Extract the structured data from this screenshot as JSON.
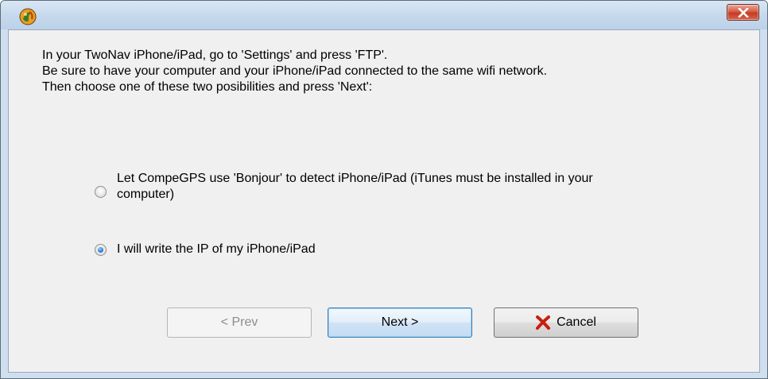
{
  "window": {
    "title": "",
    "icons": {
      "app": "compegps-app-icon",
      "close": "close-icon"
    },
    "colors": {
      "close_button": "#c63a22",
      "frame": "#cfdfef",
      "client_bg": "#f0f0f0",
      "radio_selected": "#2c7fd4",
      "cancel_icon": "#c81e0e"
    }
  },
  "instructions": [
    "In your TwoNav iPhone/iPad, go to 'Settings' and press 'FTP'.",
    "Be sure to have your computer and your iPhone/iPad connected to the same wifi network.",
    "Then choose one of these two posibilities and press 'Next':"
  ],
  "options": [
    {
      "line1": "Let CompeGPS use 'Bonjour' to detect iPhone/iPad (iTunes must be installed in your",
      "line2": "computer)",
      "selected": false
    },
    {
      "line1": "I will write the IP of my iPhone/iPad",
      "selected": true
    }
  ],
  "buttons": {
    "prev": "< Prev",
    "next": "Next >",
    "cancel": "Cancel",
    "cancel_icon": "x-cancel-icon",
    "prev_enabled": false
  }
}
